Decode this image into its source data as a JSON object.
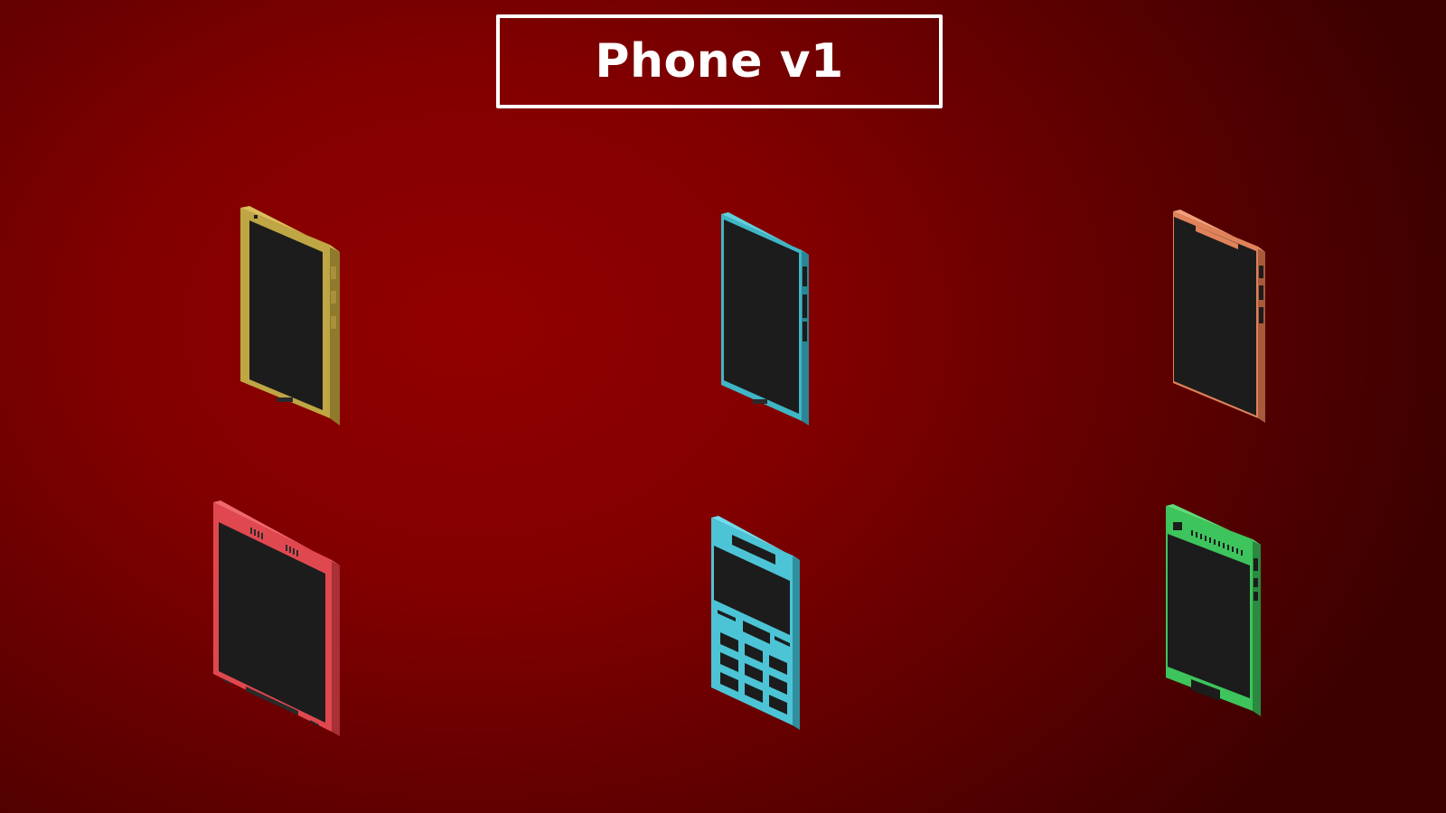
{
  "title": "Phone v1",
  "background": {
    "center": "#920000",
    "edge": "#3d0000"
  },
  "phones": [
    {
      "name": "phone-yellow",
      "frame": "#bfa644",
      "frame_dark": "#8f7a2c",
      "screen": "#1c1c1c"
    },
    {
      "name": "phone-teal",
      "frame": "#3fb6c6",
      "frame_dark": "#2a8694",
      "screen": "#1c1c1c"
    },
    {
      "name": "phone-orange",
      "frame": "#e0825a",
      "frame_dark": "#a85a3a",
      "screen": "#1c1c1c"
    },
    {
      "name": "phone-red",
      "frame": "#e0484f",
      "frame_dark": "#a83036",
      "screen": "#1c1c1c"
    },
    {
      "name": "phone-keypad",
      "frame": "#4cc4d6",
      "frame_dark": "#2f8f9e",
      "screen": "#1c1c1c"
    },
    {
      "name": "phone-green",
      "frame": "#3ec45c",
      "frame_dark": "#2a8a40",
      "screen": "#1c1c1c"
    }
  ]
}
